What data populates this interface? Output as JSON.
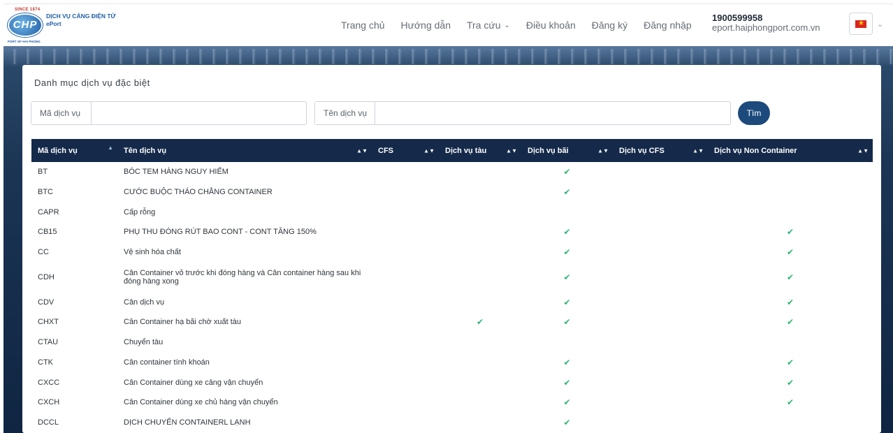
{
  "header": {
    "brand_title": "DỊCH VỤ CẢNG ĐIỆN TỬ",
    "brand_sub": "ePort",
    "logo_since": "SINCE 1874",
    "logo_mark": "CHP",
    "logo_port": "PORT OF HAI PHONG",
    "nav": [
      {
        "label": "Trang chủ"
      },
      {
        "label": "Hướng dẫn"
      },
      {
        "label": "Tra cứu"
      },
      {
        "label": "Điều khoản"
      },
      {
        "label": "Đăng ký"
      },
      {
        "label": "Đăng nhập"
      }
    ],
    "phone": "1900599958",
    "website": "eport.haiphongport.com.vn",
    "language_icon": "vietnam-flag-icon"
  },
  "card": {
    "title": "Danh mục dịch vụ đặc biệt",
    "search": {
      "code_label": "Mã dịch vụ",
      "code_value": "",
      "name_label": "Tên dịch vụ",
      "name_value": "",
      "find_label": "Tìm"
    }
  },
  "table": {
    "columns": [
      "Mã dịch vụ",
      "Tên dịch vụ",
      "CFS",
      "Dịch vụ tàu",
      "Dịch vụ bãi",
      "Dịch vụ CFS",
      "Dịch vụ Non Container"
    ],
    "rows": [
      {
        "code": "BT",
        "name": "BÓC TEM HÀNG NGUY HIỂM",
        "cfs": "",
        "tau": "",
        "bai": "✔",
        "dvcfs": "",
        "noncont": ""
      },
      {
        "code": "BTC",
        "name": "CƯỚC BUỘC THÁO CHẰNG CONTAINER",
        "cfs": "",
        "tau": "",
        "bai": "✔",
        "dvcfs": "",
        "noncont": ""
      },
      {
        "code": "CAPR",
        "name": "Cấp rỗng",
        "cfs": "",
        "tau": "",
        "bai": "",
        "dvcfs": "",
        "noncont": ""
      },
      {
        "code": "CB15",
        "name": "PHỤ THU ĐÓNG RÚT BAO CONT - CONT TĂNG 150%",
        "cfs": "",
        "tau": "",
        "bai": "✔",
        "dvcfs": "",
        "noncont": "✔"
      },
      {
        "code": "CC",
        "name": "Vệ sinh hóa chất",
        "cfs": "",
        "tau": "",
        "bai": "✔",
        "dvcfs": "",
        "noncont": "✔"
      },
      {
        "code": "CDH",
        "name": "Cân Container vỏ trước khi đóng hàng và Cân container hàng sau khi đóng hàng xong",
        "cfs": "",
        "tau": "",
        "bai": "✔",
        "dvcfs": "",
        "noncont": "✔"
      },
      {
        "code": "CDV",
        "name": "Cân dịch vụ",
        "cfs": "",
        "tau": "",
        "bai": "✔",
        "dvcfs": "",
        "noncont": "✔"
      },
      {
        "code": "CHXT",
        "name": "Cân Container hạ bãi chờ xuất tàu",
        "cfs": "",
        "tau": "✔",
        "bai": "✔",
        "dvcfs": "",
        "noncont": "✔"
      },
      {
        "code": "CTAU",
        "name": "Chuyển tàu",
        "cfs": "",
        "tau": "",
        "bai": "",
        "dvcfs": "",
        "noncont": ""
      },
      {
        "code": "CTK",
        "name": "Cân container tính khoán",
        "cfs": "",
        "tau": "",
        "bai": "✔",
        "dvcfs": "",
        "noncont": "✔"
      },
      {
        "code": "CXCC",
        "name": "Cân Container dùng xe cảng vận chuyển",
        "cfs": "",
        "tau": "",
        "bai": "✔",
        "dvcfs": "",
        "noncont": "✔"
      },
      {
        "code": "CXCH",
        "name": "Cân Container dùng xe chủ hàng vận chuyển",
        "cfs": "",
        "tau": "",
        "bai": "✔",
        "dvcfs": "",
        "noncont": "✔"
      },
      {
        "code": "DCCL",
        "name": "DỊCH CHUYỂN CONTAINERL LẠNH",
        "cfs": "",
        "tau": "",
        "bai": "✔",
        "dvcfs": "",
        "noncont": ""
      }
    ]
  },
  "colors": {
    "table_header": "#152a4a",
    "check": "#2bb673",
    "find_button": "#1c4a7c",
    "brand": "#1f5fa8"
  }
}
